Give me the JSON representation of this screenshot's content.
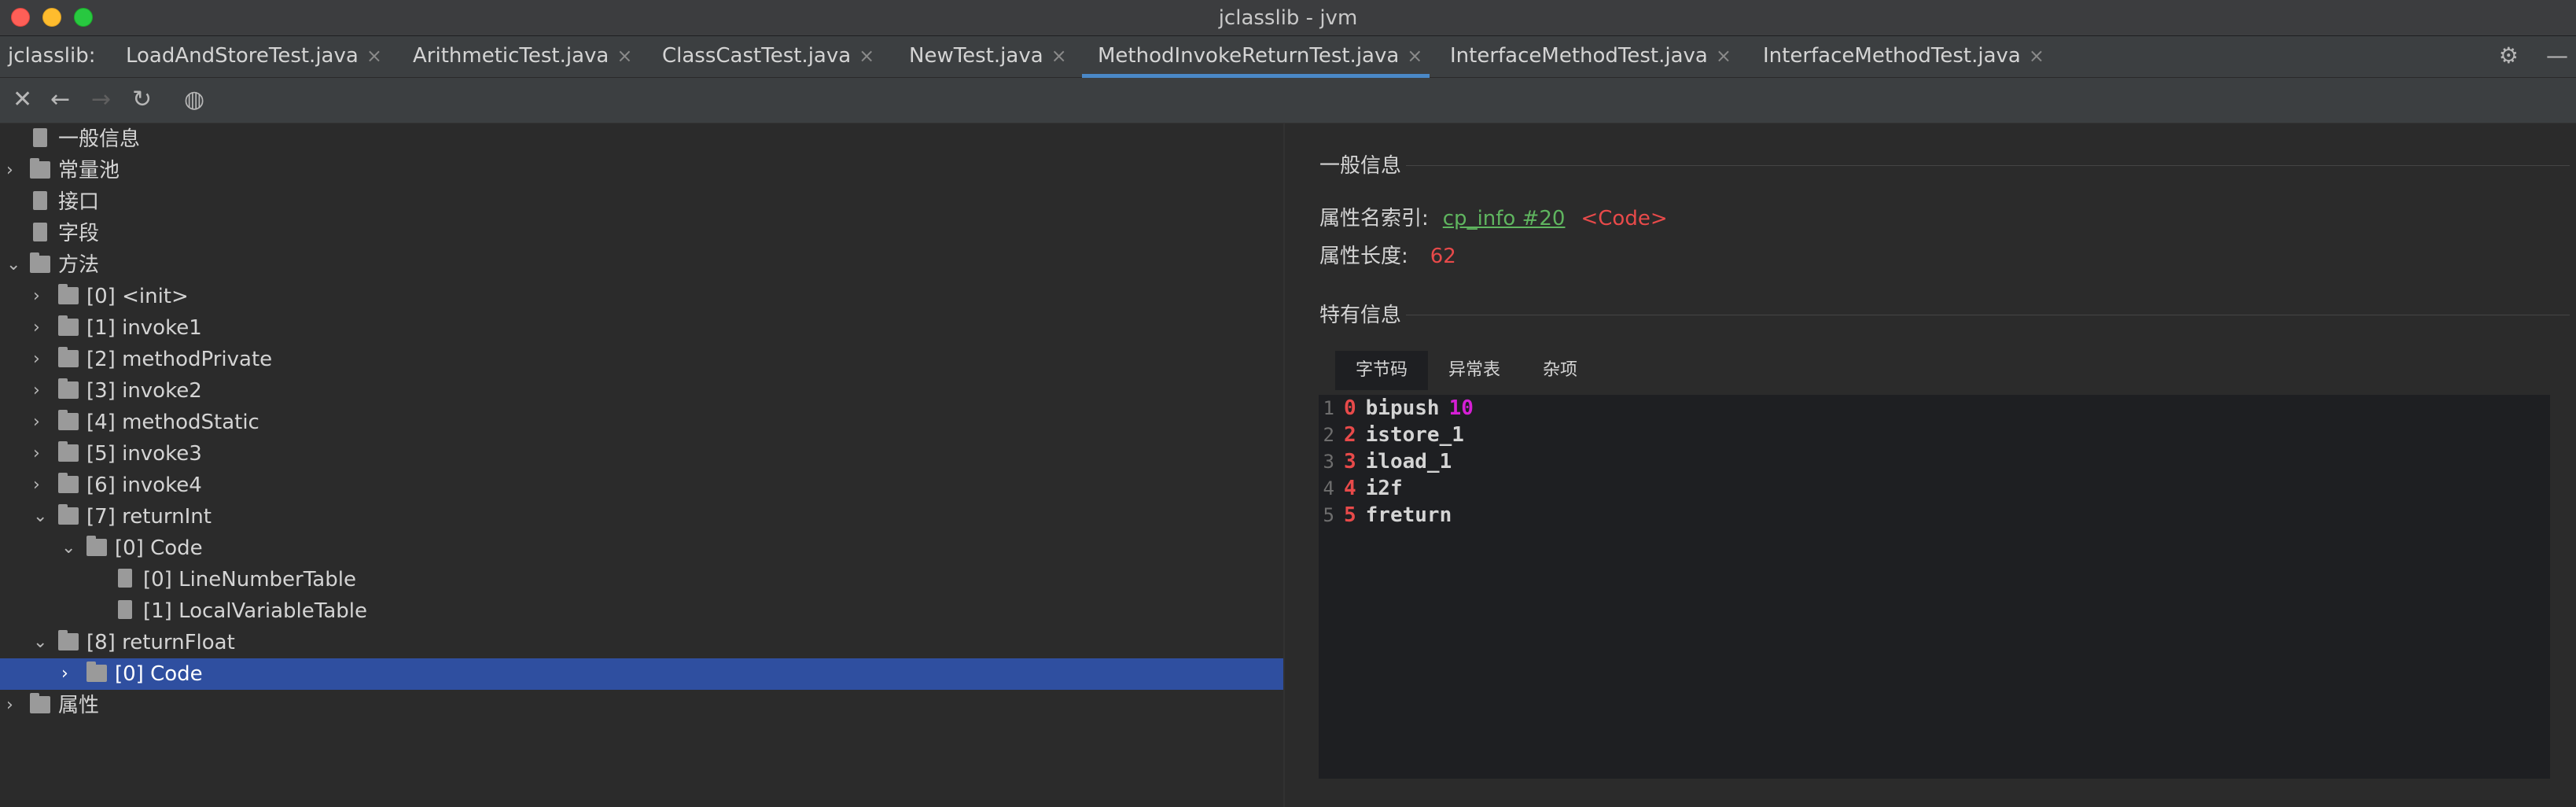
{
  "window": {
    "title": "jclasslib - jvm"
  },
  "tabbar": {
    "prefix": "jclasslib:",
    "tabs": [
      {
        "label": "LoadAndStoreTest.java"
      },
      {
        "label": "ArithmeticTest.java"
      },
      {
        "label": "ClassCastTest.java"
      },
      {
        "label": "NewTest.java"
      },
      {
        "label": "MethodInvokeReturnTest.java",
        "active": true
      },
      {
        "label": "InterfaceMethodTest.java"
      },
      {
        "label": "InterfaceMethodTest.java"
      }
    ],
    "close_glyph": "×"
  },
  "tree": {
    "items": [
      {
        "label": "一般信息"
      },
      {
        "label": "常量池"
      },
      {
        "label": "接口"
      },
      {
        "label": "字段"
      },
      {
        "label": "方法"
      },
      {
        "label": "[0] <init>"
      },
      {
        "label": "[1] invoke1"
      },
      {
        "label": "[2] methodPrivate"
      },
      {
        "label": "[3] invoke2"
      },
      {
        "label": "[4] methodStatic"
      },
      {
        "label": "[5] invoke3"
      },
      {
        "label": "[6] invoke4"
      },
      {
        "label": "[7] returnInt"
      },
      {
        "label": "[0] Code"
      },
      {
        "label": "[0] LineNumberTable"
      },
      {
        "label": "[1] LocalVariableTable"
      },
      {
        "label": "[8] returnFloat"
      },
      {
        "label": "[0] Code",
        "selected": true
      },
      {
        "label": "属性"
      }
    ]
  },
  "general": {
    "section_title": "一般信息",
    "name_index_label": "属性名索引:",
    "name_index_link": "cp_info #20",
    "name_index_value": "<Code>",
    "length_label": "属性长度:",
    "length_value": "62"
  },
  "specific": {
    "section_title": "特有信息",
    "subtabs": [
      {
        "label": "字节码",
        "active": true
      },
      {
        "label": "异常表"
      },
      {
        "label": "杂项"
      }
    ]
  },
  "bytecode": [
    {
      "line": "1",
      "offset": "0",
      "op": "bipush",
      "arg": "10"
    },
    {
      "line": "2",
      "offset": "2",
      "op": "istore_1",
      "arg": ""
    },
    {
      "line": "3",
      "offset": "3",
      "op": "iload_1",
      "arg": ""
    },
    {
      "line": "4",
      "offset": "4",
      "op": "i2f",
      "arg": ""
    },
    {
      "line": "5",
      "offset": "5",
      "op": "freturn",
      "arg": ""
    }
  ],
  "icons": {
    "settings": "gear-icon",
    "minimize": "minus-icon",
    "close": "close-icon",
    "back": "back-arrow-icon",
    "forward": "forward-arrow-icon",
    "refresh": "refresh-icon",
    "browser": "globe-icon"
  },
  "colors": {
    "selection": "#2f4fa0",
    "active_tab_underline": "#4a88c7",
    "link": "#5fb55f",
    "offset": "#e84a4a",
    "argument": "#d51fd5"
  }
}
